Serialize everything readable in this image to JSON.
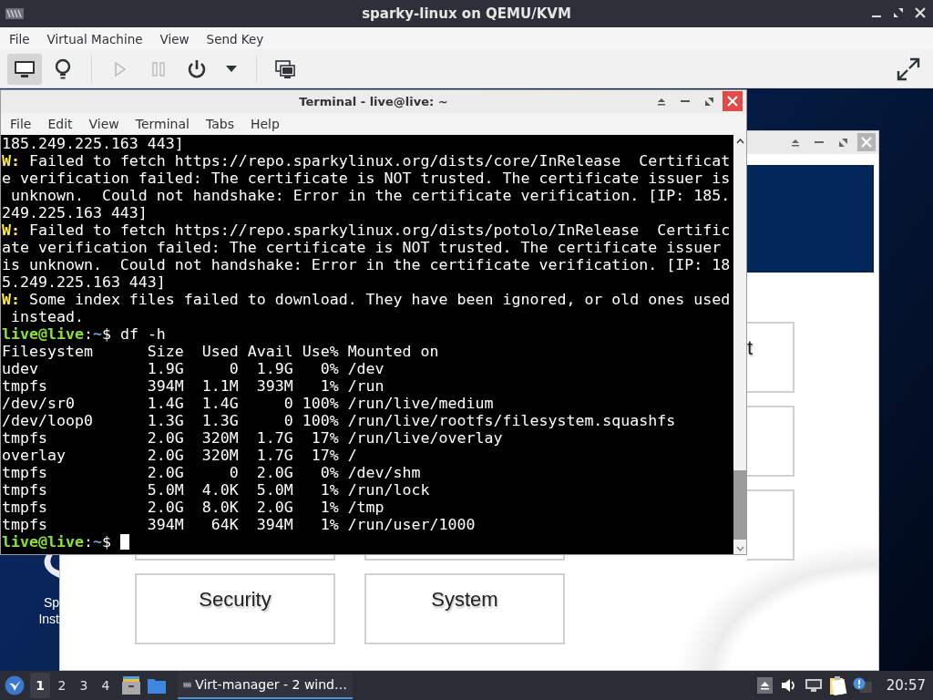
{
  "window": {
    "title": "sparky-linux on QEMU/KVM"
  },
  "menu": [
    "File",
    "Virtual Machine",
    "View",
    "Send Key"
  ],
  "toolbar": [
    {
      "kind": "monitor",
      "pressed": true
    },
    {
      "kind": "bulb",
      "pressed": false
    },
    {
      "kind": "separator"
    },
    {
      "kind": "play",
      "disabled": true
    },
    {
      "kind": "pause",
      "disabled": true
    },
    {
      "kind": "power",
      "disabled": false
    },
    {
      "kind": "dropdown"
    },
    {
      "kind": "separator"
    },
    {
      "kind": "screenshots"
    },
    {
      "kind": "fullscreen"
    }
  ],
  "guest": {
    "desktop_icon": {
      "label_lines": [
        "Sp",
        "Inst"
      ]
    },
    "app_window": {
      "tiles": [
        {
          "kind": "labeled",
          "label": "t"
        },
        {
          "kind": "blank"
        },
        {
          "kind": "blank"
        },
        {
          "kind": "blank"
        },
        {
          "kind": "blank"
        },
        {
          "kind": "labeled",
          "label": "Security"
        },
        {
          "kind": "labeled",
          "label": "System"
        }
      ]
    },
    "terminal": {
      "title": "Terminal - live@live: ~",
      "menu": [
        "File",
        "Edit",
        "View",
        "Terminal",
        "Tabs",
        "Help"
      ],
      "lines": [
        {
          "kind": "output",
          "text": "185.249.225.163 443]"
        },
        {
          "kind": "warning",
          "prefix": "W:",
          "text": " Failed to fetch https://repo.sparkylinux.org/dists/core/InRelease  Certificat"
        },
        {
          "kind": "output",
          "text": "e verification failed: The certificate is NOT trusted. The certificate issuer is"
        },
        {
          "kind": "output",
          "text": " unknown.  Could not handshake: Error in the certificate verification. [IP: 185."
        },
        {
          "kind": "output",
          "text": "249.225.163 443]"
        },
        {
          "kind": "warning",
          "prefix": "W:",
          "text": " Failed to fetch https://repo.sparkylinux.org/dists/potolo/InRelease  Certific"
        },
        {
          "kind": "output",
          "text": "ate verification failed: The certificate is NOT trusted. The certificate issuer"
        },
        {
          "kind": "output",
          "text": "is unknown.  Could not handshake: Error in the certificate verification. [IP: 18"
        },
        {
          "kind": "output",
          "text": "5.249.225.163 443]"
        },
        {
          "kind": "warning",
          "prefix": "W:",
          "text": " Some index files failed to download. They have been ignored, or old ones used"
        },
        {
          "kind": "output",
          "text": " instead."
        },
        {
          "kind": "prompt",
          "host": "live@live",
          "sep": ":",
          "path": "~",
          "symbol": "$",
          "command": " df -h"
        },
        {
          "kind": "output",
          "text": "Filesystem      Size  Used Avail Use% Mounted on"
        },
        {
          "kind": "output",
          "text": "udev            1.9G     0  1.9G   0% /dev"
        },
        {
          "kind": "output",
          "text": "tmpfs           394M  1.1M  393M   1% /run"
        },
        {
          "kind": "output",
          "text": "/dev/sr0        1.4G  1.4G     0 100% /run/live/medium"
        },
        {
          "kind": "output",
          "text": "/dev/loop0      1.3G  1.3G     0 100% /run/live/rootfs/filesystem.squashfs"
        },
        {
          "kind": "output",
          "text": "tmpfs           2.0G  320M  1.7G  17% /run/live/overlay"
        },
        {
          "kind": "output",
          "text": "overlay         2.0G  320M  1.7G  17% /"
        },
        {
          "kind": "output",
          "text": "tmpfs           2.0G     0  2.0G   0% /dev/shm"
        },
        {
          "kind": "output",
          "text": "tmpfs           5.0M  4.0K  5.0M   1% /run/lock"
        },
        {
          "kind": "output",
          "text": "tmpfs           2.0G  8.0K  2.0G   1% /tmp"
        },
        {
          "kind": "output",
          "text": "tmpfs           394M   64K  394M   1% /run/user/1000"
        },
        {
          "kind": "prompt",
          "host": "live@live",
          "sep": ":",
          "path": "~",
          "symbol": "$",
          "cursor": true
        }
      ]
    },
    "taskbar": {
      "workspaces": [
        {
          "label": "1",
          "selected": true
        },
        {
          "label": "2",
          "selected": false
        },
        {
          "label": "3",
          "selected": false
        },
        {
          "label": "4",
          "selected": false
        }
      ],
      "launchers": [
        {
          "kind": "file-cabinet"
        },
        {
          "kind": "folder"
        }
      ],
      "task": {
        "label": "Virt-manager - 2 wind…",
        "selected": true
      },
      "tray": [
        {
          "kind": "eject"
        },
        {
          "kind": "volume"
        },
        {
          "kind": "network"
        },
        {
          "kind": "notes"
        },
        {
          "kind": "notification"
        }
      ],
      "clock": "20:57"
    }
  }
}
